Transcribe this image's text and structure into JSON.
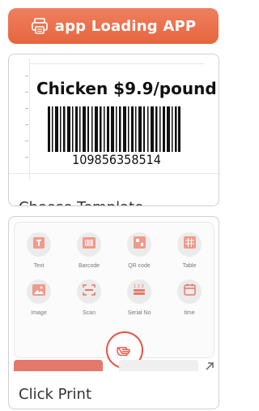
{
  "banner": {
    "title": "app Loading APP",
    "icon": "printer-app-icon"
  },
  "template_card": {
    "caption": "Choose Template",
    "label": {
      "product_text": "Chicken $9.9/pound",
      "barcode_number": "109856358514"
    }
  },
  "print_card": {
    "caption": "Click Print",
    "tools": [
      {
        "label": "Text",
        "icon": "text-icon"
      },
      {
        "label": "Barcode",
        "icon": "barcode-icon"
      },
      {
        "label": "QR code",
        "icon": "qr-code-icon"
      },
      {
        "label": "Table",
        "icon": "table-icon"
      },
      {
        "label": "Image",
        "icon": "image-icon"
      },
      {
        "label": "Scan",
        "icon": "scan-icon"
      },
      {
        "label": "Serial No",
        "icon": "serial-number-icon"
      },
      {
        "label": "time",
        "icon": "calendar-icon"
      }
    ]
  },
  "colors": {
    "accent": "#e6663e",
    "print_button": "#e4796b",
    "tap_ring": "#e85545"
  }
}
